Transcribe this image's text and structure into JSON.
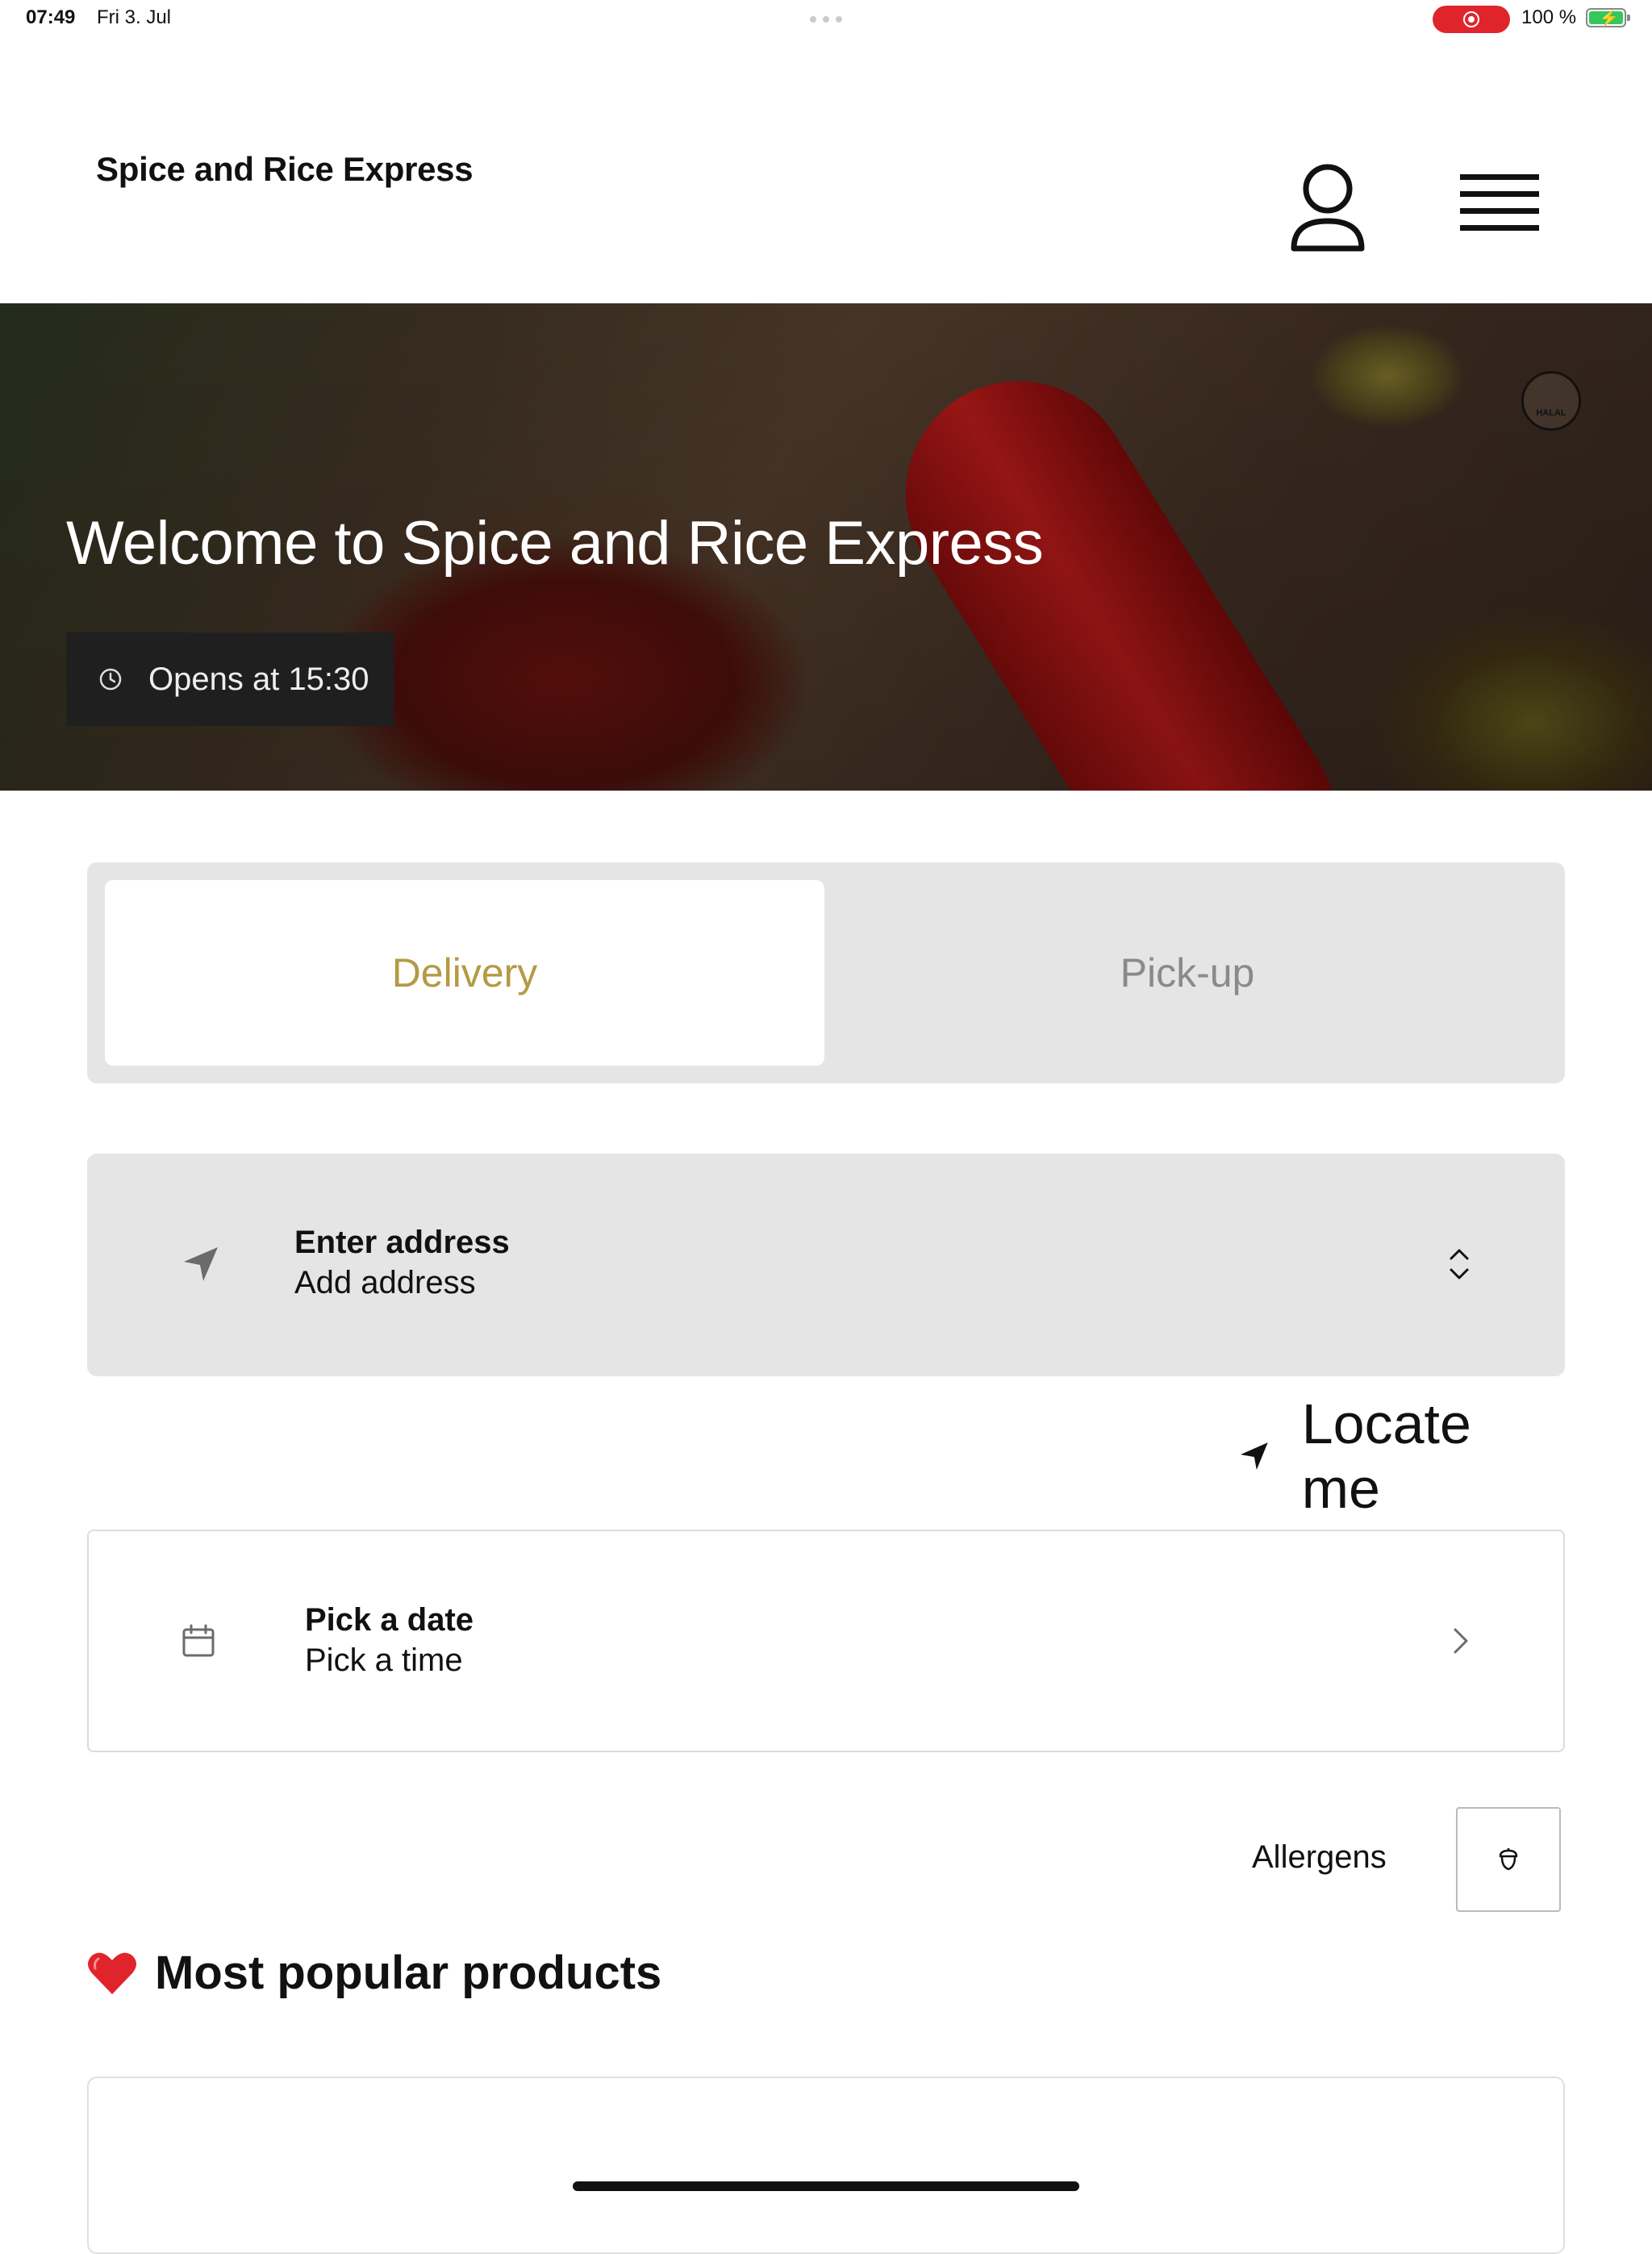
{
  "status_bar": {
    "time": "07:49",
    "date": "Fri 3. Jul",
    "battery_text": "100 %",
    "battery_level_percent": 100,
    "recording": true
  },
  "header": {
    "brand": "Spice and Rice Express",
    "account_icon": "person-icon",
    "menu_icon": "hamburger-menu-icon"
  },
  "hero": {
    "title": "Welcome to Spice and Rice Express",
    "hours_text": "Opens at 15:30",
    "badge_text": "HALAL",
    "badge_icon": "halal-icon"
  },
  "mode": {
    "options": [
      "Delivery",
      "Pick-up"
    ],
    "selected": "Delivery",
    "active_color": "#b49a44"
  },
  "address": {
    "title": "Enter address",
    "subtitle": "Add address"
  },
  "locate": {
    "label": "Locate me"
  },
  "schedule": {
    "title": "Pick a date",
    "subtitle": "Pick a time"
  },
  "allergens": {
    "label": "Allergens",
    "icon": "acorn-icon"
  },
  "popular": {
    "title": "Most popular products",
    "emoji_icon": "heart-icon"
  }
}
